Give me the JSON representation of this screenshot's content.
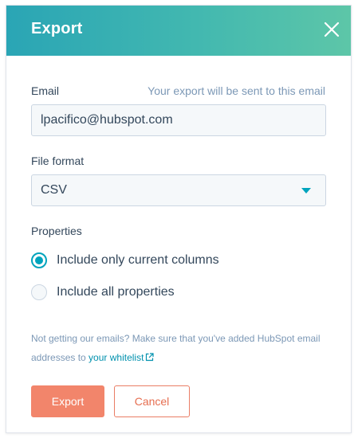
{
  "dialog": {
    "title": "Export",
    "close_icon": "close-icon"
  },
  "email": {
    "label": "Email",
    "hint": "Your export will be sent to this email",
    "value": "lpacifico@hubspot.com"
  },
  "file_format": {
    "label": "File format",
    "selected": "CSV"
  },
  "properties": {
    "label": "Properties",
    "options": [
      {
        "label": "Include only current columns",
        "checked": true
      },
      {
        "label": "Include all properties",
        "checked": false
      }
    ]
  },
  "note": {
    "text": "Not getting our emails? Make sure that you've added HubSpot email addresses to ",
    "link": "your whitelist",
    "link_icon": "external-link-icon"
  },
  "buttons": {
    "export": "Export",
    "cancel": "Cancel"
  },
  "colors": {
    "header_start": "#2aa5b5",
    "header_end": "#5dc6a8",
    "accent": "#00a4bd",
    "primary_button": "#f2856b",
    "link": "#0091ae"
  }
}
